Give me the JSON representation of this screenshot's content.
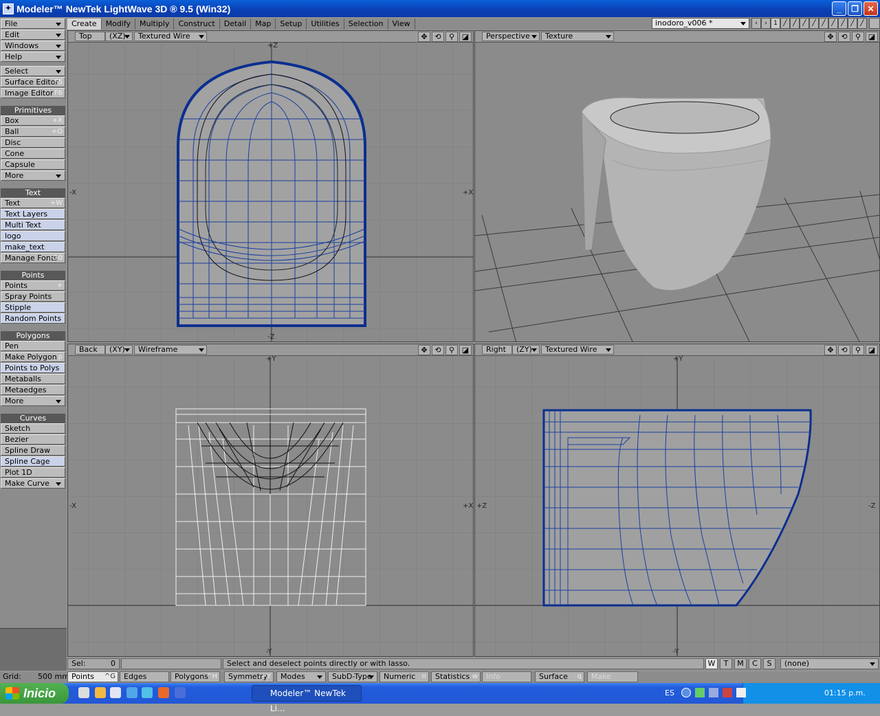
{
  "window": {
    "title": "Modeler™ NewTek LightWave 3D ® 9.5  (Win32)"
  },
  "menus": {
    "file": "File",
    "edit": "Edit",
    "windows": "Windows",
    "help": "Help",
    "select": "Select",
    "surface_editor": "Surface Editor",
    "surface_editor_key": "F5",
    "image_editor": "Image Editor",
    "image_editor_key": "F6"
  },
  "tabs": [
    "Create",
    "Modify",
    "Multiply",
    "Construct",
    "Detail",
    "Map",
    "Setup",
    "Utilities",
    "Selection",
    "View"
  ],
  "scene_file": "inodoro_v006 *",
  "layer_number": "1",
  "panels": {
    "primitives": {
      "title": "Primitives",
      "items": [
        "Box",
        "Ball",
        "Disc",
        "Cone",
        "Capsule",
        "More"
      ],
      "keys": [
        "+X",
        "+O"
      ]
    },
    "text": {
      "title": "Text",
      "items": [
        "Text",
        "Text Layers",
        "Multi Text",
        "logo",
        "make_text",
        "Manage Fonts"
      ],
      "keys": [
        "+W",
        "F10"
      ]
    },
    "points": {
      "title": "Points",
      "items": [
        "Points",
        "Spray Points",
        "Stipple",
        "Random Points"
      ],
      "keys": [
        "+"
      ]
    },
    "polygons": {
      "title": "Polygons",
      "items": [
        "Pen",
        "Make Polygon",
        "Points to Polys",
        "Metaballs",
        "Metaedges",
        "More"
      ],
      "keys": [
        "p"
      ]
    },
    "curves": {
      "title": "Curves",
      "items": [
        "Sketch",
        "Bezier",
        "Spline Draw",
        "Spline Cage",
        "Plot 1D",
        "Make Curve"
      ]
    }
  },
  "viewports": {
    "top": {
      "view": "Top",
      "axis": "(XZ)",
      "mode": "Textured Wire"
    },
    "persp": {
      "view": "Perspective",
      "mode": "Texture"
    },
    "back": {
      "view": "Back",
      "axis": "(XY)",
      "mode": "Wireframe"
    },
    "right": {
      "view": "Right",
      "axis": "(ZY)",
      "mode": "Textured Wire"
    }
  },
  "axis_labels": {
    "pz": "+Z",
    "mz": "-Z",
    "px": "+X",
    "mx": "-X",
    "py": "+Y",
    "my": "-Y"
  },
  "status": {
    "sel_label": "Sel:",
    "sel_value": "0",
    "hint": "Select and deselect points directly or with lasso.",
    "wtmcs": [
      "W",
      "T",
      "M",
      "C",
      "S"
    ],
    "surface_value": "(none)"
  },
  "bottom": {
    "grid_label": "Grid:",
    "grid_value": "500 mm",
    "points": "Points",
    "points_key": "^G",
    "edges": "Edges",
    "polygons": "Polygons",
    "polygons_key": "^H",
    "symmetry": "Symmetry",
    "symmetry_key": "+Y",
    "modes": "Modes",
    "subd": "SubD-Type",
    "numeric": "Numeric",
    "numeric_key": "n",
    "statistics": "Statistics",
    "statistics_key": "w",
    "info": "Info",
    "surface": "Surface",
    "surface_key": "q",
    "make": "Make"
  },
  "taskbar": {
    "start": "Inicio",
    "item": "Modeler™ NewTek Li...",
    "lang": "ES",
    "clock": "01:15 p.m."
  },
  "colors": {
    "wire": "#0b2f8f",
    "viewport": "#8b8b8b",
    "grid": "#7a7a7a"
  }
}
